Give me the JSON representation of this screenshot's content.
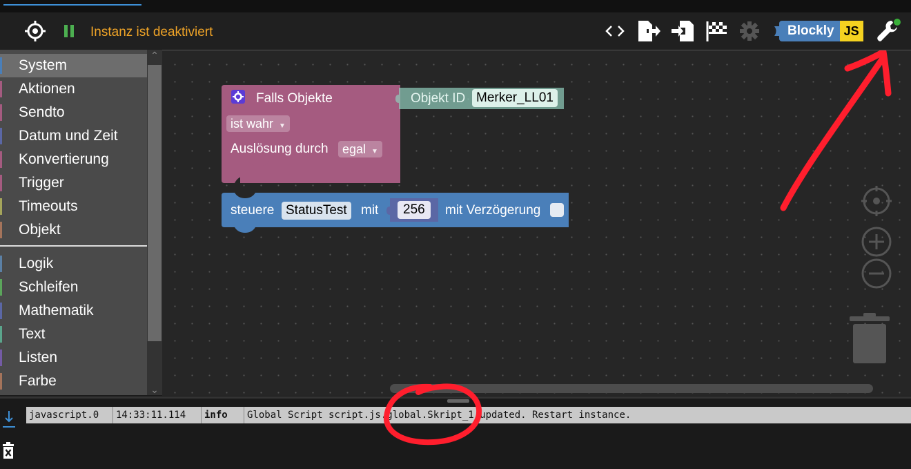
{
  "toolbar": {
    "status_text": "Instanz ist deaktiviert",
    "blockly_label": "Blockly",
    "js_label": "JS",
    "status_color": "#f0a427",
    "icons": [
      "target-icon",
      "pause-icon",
      "code-icon",
      "export-icon",
      "import-icon",
      "flag-icon",
      "gear-icon",
      "blockly-js-toggle",
      "wrench-icon"
    ]
  },
  "sidebar": {
    "items": [
      {
        "label": "System",
        "color": "#4a7fb9"
      },
      {
        "label": "Aktionen",
        "color": "#a55b80"
      },
      {
        "label": "Sendto",
        "color": "#a55b80"
      },
      {
        "label": "Datum und Zeit",
        "color": "#5b67a5"
      },
      {
        "label": "Konvertierung",
        "color": "#a55b80"
      },
      {
        "label": "Trigger",
        "color": "#a55b80"
      },
      {
        "label": "Timeouts",
        "color": "#a5a55b"
      },
      {
        "label": "Objekt",
        "color": "#a5745b"
      },
      {
        "label": "Logik",
        "color": "#5b80a5"
      },
      {
        "label": "Schleifen",
        "color": "#5ba55b"
      },
      {
        "label": "Mathematik",
        "color": "#5b67a5"
      },
      {
        "label": "Text",
        "color": "#5ba58c"
      },
      {
        "label": "Listen",
        "color": "#745ba5"
      },
      {
        "label": "Farbe",
        "color": "#a5745b"
      }
    ]
  },
  "blocks": {
    "trigger": {
      "title": "Falls Objekte",
      "condition": "ist wahr",
      "trigger_label": "Auslösung durch",
      "trigger_value": "egal",
      "object_id_label": "Objekt ID",
      "object_id_value": "Merker_LL01"
    },
    "control": {
      "label": "steuere",
      "target": "StatusTest",
      "with_label": "mit",
      "value": "256",
      "delay_label": "mit Verzögerung"
    }
  },
  "log": {
    "source": "javascript.0",
    "time": "14:33:11.114",
    "level": "info",
    "message": "Global Script script.js.global.Skript_1 updated. Restart instance."
  }
}
